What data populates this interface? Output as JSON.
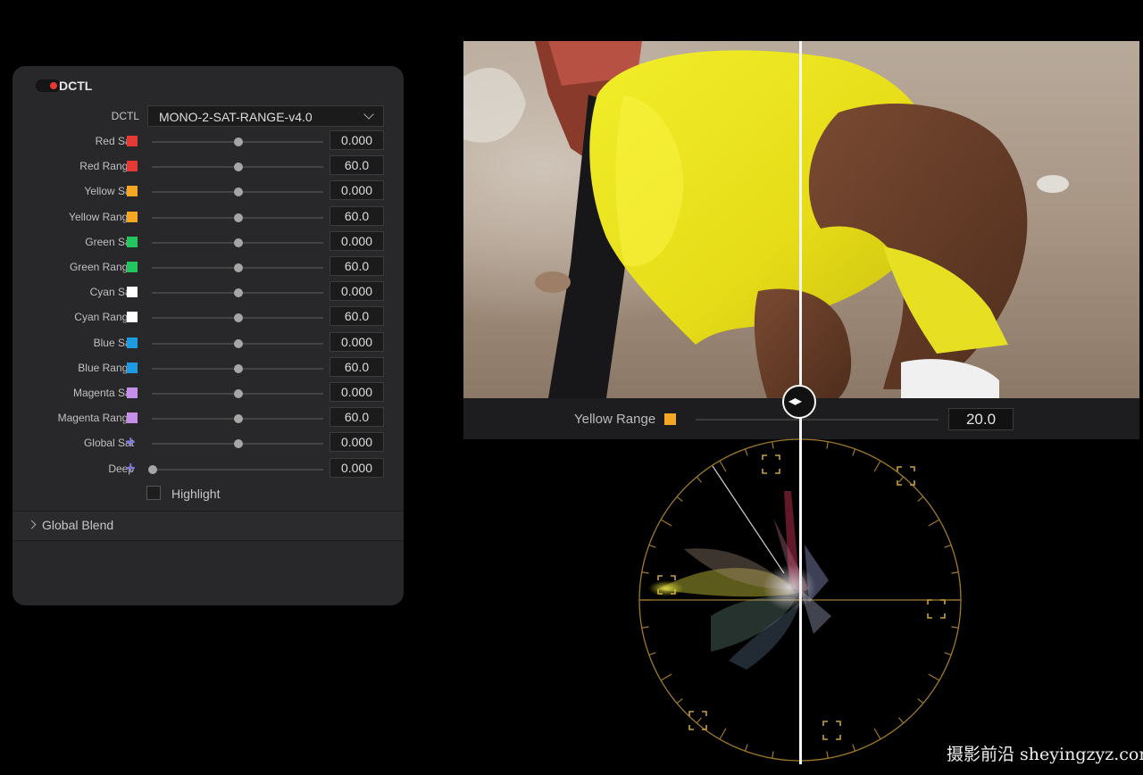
{
  "panel": {
    "title": "DCTL",
    "enabled": true,
    "dctl_label": "DCTL",
    "dctl_value": "MONO-2-SAT-RANGE-v4.0",
    "params": [
      {
        "label": "Red Sat",
        "value": "0.000",
        "color": "#e53935",
        "slider": 0.5,
        "icon": "swatch"
      },
      {
        "label": "Red Range",
        "value": "60.0",
        "color": "#e53935",
        "slider": 0.5,
        "icon": "swatch"
      },
      {
        "label": "Yellow Sat",
        "value": "0.000",
        "color": "#f5a623",
        "slider": 0.5,
        "icon": "swatch"
      },
      {
        "label": "Yellow Range",
        "value": "60.0",
        "color": "#f5a623",
        "slider": 0.5,
        "icon": "swatch"
      },
      {
        "label": "Green Sat",
        "value": "0.000",
        "color": "#22c55e",
        "slider": 0.5,
        "icon": "swatch"
      },
      {
        "label": "Green Range",
        "value": "60.0",
        "color": "#22c55e",
        "slider": 0.5,
        "icon": "swatch"
      },
      {
        "label": "Cyan Sat",
        "value": "0.000",
        "color": "#ffffff",
        "slider": 0.5,
        "icon": "swatch"
      },
      {
        "label": "Cyan Range",
        "value": "60.0",
        "color": "#ffffff",
        "slider": 0.5,
        "icon": "swatch"
      },
      {
        "label": "Blue Sat",
        "value": "0.000",
        "color": "#1e9be0",
        "slider": 0.5,
        "icon": "swatch"
      },
      {
        "label": "Blue Range",
        "value": "60.0",
        "color": "#1e9be0",
        "slider": 0.5,
        "icon": "swatch"
      },
      {
        "label": "Magenta Sat",
        "value": "0.000",
        "color": "#c58ee8",
        "slider": 0.5,
        "icon": "swatch"
      },
      {
        "label": "Magenta Range",
        "value": "60.0",
        "color": "#c58ee8",
        "slider": 0.5,
        "icon": "swatch"
      },
      {
        "label": "Global Sat",
        "value": "0.000",
        "color": "#7a78e0",
        "slider": 0.5,
        "icon": "plus"
      },
      {
        "label": "Deep",
        "value": "0.000",
        "color": "#7a78e0",
        "slider": 0.0,
        "icon": "plus"
      }
    ],
    "highlight_label": "Highlight",
    "highlight_checked": false,
    "global_blend_label": "Global Blend"
  },
  "viewer_bar": {
    "label": "Yellow Range",
    "color": "#f5a623",
    "value": "20.0",
    "slider": 0.25
  },
  "wipe_icon": "horizontal-arrows-icon",
  "scope_icon": "vectorscope",
  "watermark": "摄影前沿 sheyingzyz.com"
}
